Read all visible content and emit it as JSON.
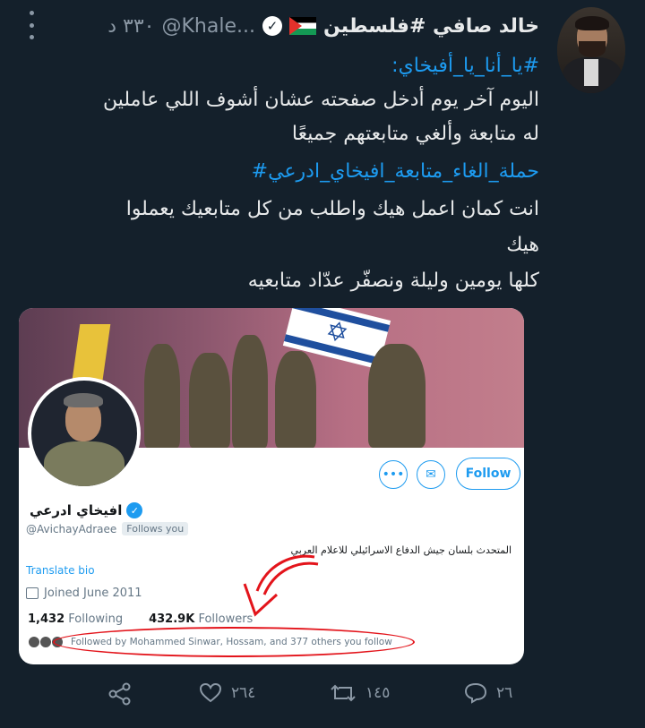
{
  "tweet": {
    "author_name": "خالد صافي #فلسطين",
    "handle": "@Khale...",
    "time": "٣٣٠ د",
    "lines": [
      {
        "text": "#يا_أنا_يا_أفيخاي:",
        "hashtag": true
      },
      {
        "text": "اليوم آخر يوم أدخل صفحته عشان أشوف اللي عاملين",
        "hashtag": false
      },
      {
        "text": "له متابعة وألغي متابعتهم جميعًا",
        "hashtag": false
      },
      {
        "text": "حملة_الغاء_متابعة_افيخاي_ادرعي#",
        "hashtag": true
      },
      {
        "text": "انت كمان اعمل هيك واطلب من كل متابعيك يعملوا",
        "hashtag": false
      },
      {
        "text": "هيك",
        "hashtag": false
      },
      {
        "text": "كلها يومين وليلة ونصفّر عدّاد متابعيه",
        "hashtag": false
      }
    ]
  },
  "card": {
    "follow_label": "Follow",
    "name": "افيخاي ادرعي",
    "handle": "@AvichayAdraee",
    "follows_you": "Follows you",
    "bio": "المتحدث بلسان جيش الدفاع الاسرائيلي للاعلام العربي",
    "translate": "Translate bio",
    "joined": "Joined June 2011",
    "following_count": "1,432",
    "following_label": "Following",
    "followers_count": "432.9K",
    "followers_label": "Followers",
    "followed_by": "Followed by Mohammed Sinwar, Hossam, and 377 others you follow"
  },
  "actions": {
    "reply_count": "٢٦",
    "retweet_count": "١٤٥",
    "like_count": "٢٦٤"
  },
  "icons": [
    "more-icon",
    "verified-icon",
    "palestine-flag-icon",
    "more-options-icon",
    "message-icon",
    "calendar-icon",
    "reply-icon",
    "retweet-icon",
    "like-icon",
    "share-icon"
  ],
  "colors": {
    "background": "#14202b",
    "accent": "#1d9bf0",
    "annotation_red": "#e3141b"
  }
}
